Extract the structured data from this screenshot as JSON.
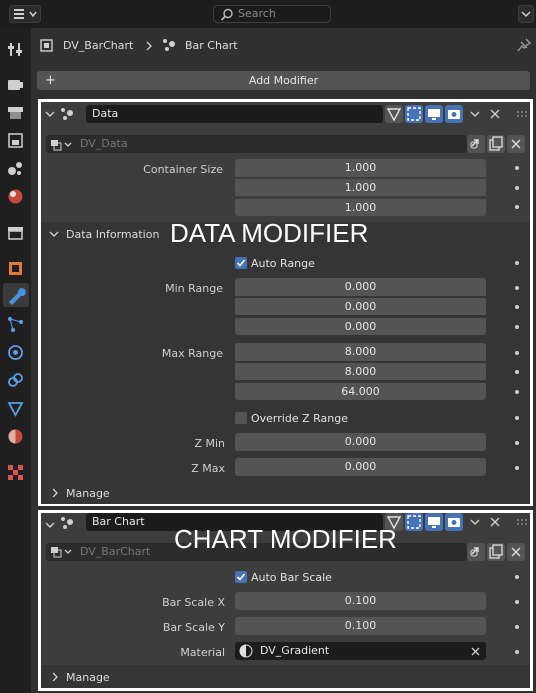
{
  "topbar": {
    "search_placeholder": "Search"
  },
  "breadcrumb": {
    "object_name": "DV_BarChart",
    "modifier_name": "Bar Chart"
  },
  "toolbar": {
    "add_modifier_label": "Add Modifier"
  },
  "data_modifier": {
    "name": "Data",
    "node_group": "DV_Data",
    "annotation": "DATA MODIFIER",
    "container_size_label": "Container Size",
    "container_size": [
      "1.000",
      "1.000",
      "1.000"
    ],
    "data_info_label": "Data Information",
    "auto_range_label": "Auto Range",
    "auto_range": true,
    "min_range_label": "Min Range",
    "min_range": [
      "0.000",
      "0.000",
      "0.000"
    ],
    "max_range_label": "Max Range",
    "max_range": [
      "8.000",
      "8.000",
      "64.000"
    ],
    "override_z_label": "Override Z Range",
    "override_z": false,
    "z_min_label": "Z Min",
    "z_min": "0.000",
    "z_max_label": "Z Max",
    "z_max": "0.000",
    "manage_label": "Manage"
  },
  "chart_modifier": {
    "name": "Bar Chart",
    "node_group": "DV_BarChart",
    "annotation": "CHART MODIFIER",
    "auto_bar_scale_label": "Auto Bar Scale",
    "auto_bar_scale": true,
    "bar_scale_x_label": "Bar Scale X",
    "bar_scale_x": "0.100",
    "bar_scale_y_label": "Bar Scale Y",
    "bar_scale_y": "0.100",
    "material_label": "Material",
    "material": "DV_Gradient",
    "manage_label": "Manage"
  },
  "colors": {
    "accent": "#4772b3",
    "panel_bg": "#3d3d3d",
    "field_bg": "#545454",
    "sidebar_bg": "#1f1f1f"
  },
  "icons": [
    "editor-type-icon",
    "search-icon",
    "tool-icon",
    "render-icon",
    "output-icon",
    "view-layer-icon",
    "scene-icon",
    "world-icon",
    "collection-icon",
    "object-icon",
    "modifier-icon",
    "particles-icon",
    "physics-icon",
    "constraints-icon",
    "data-icon",
    "material-icon",
    "texture-icon",
    "pin-icon"
  ]
}
